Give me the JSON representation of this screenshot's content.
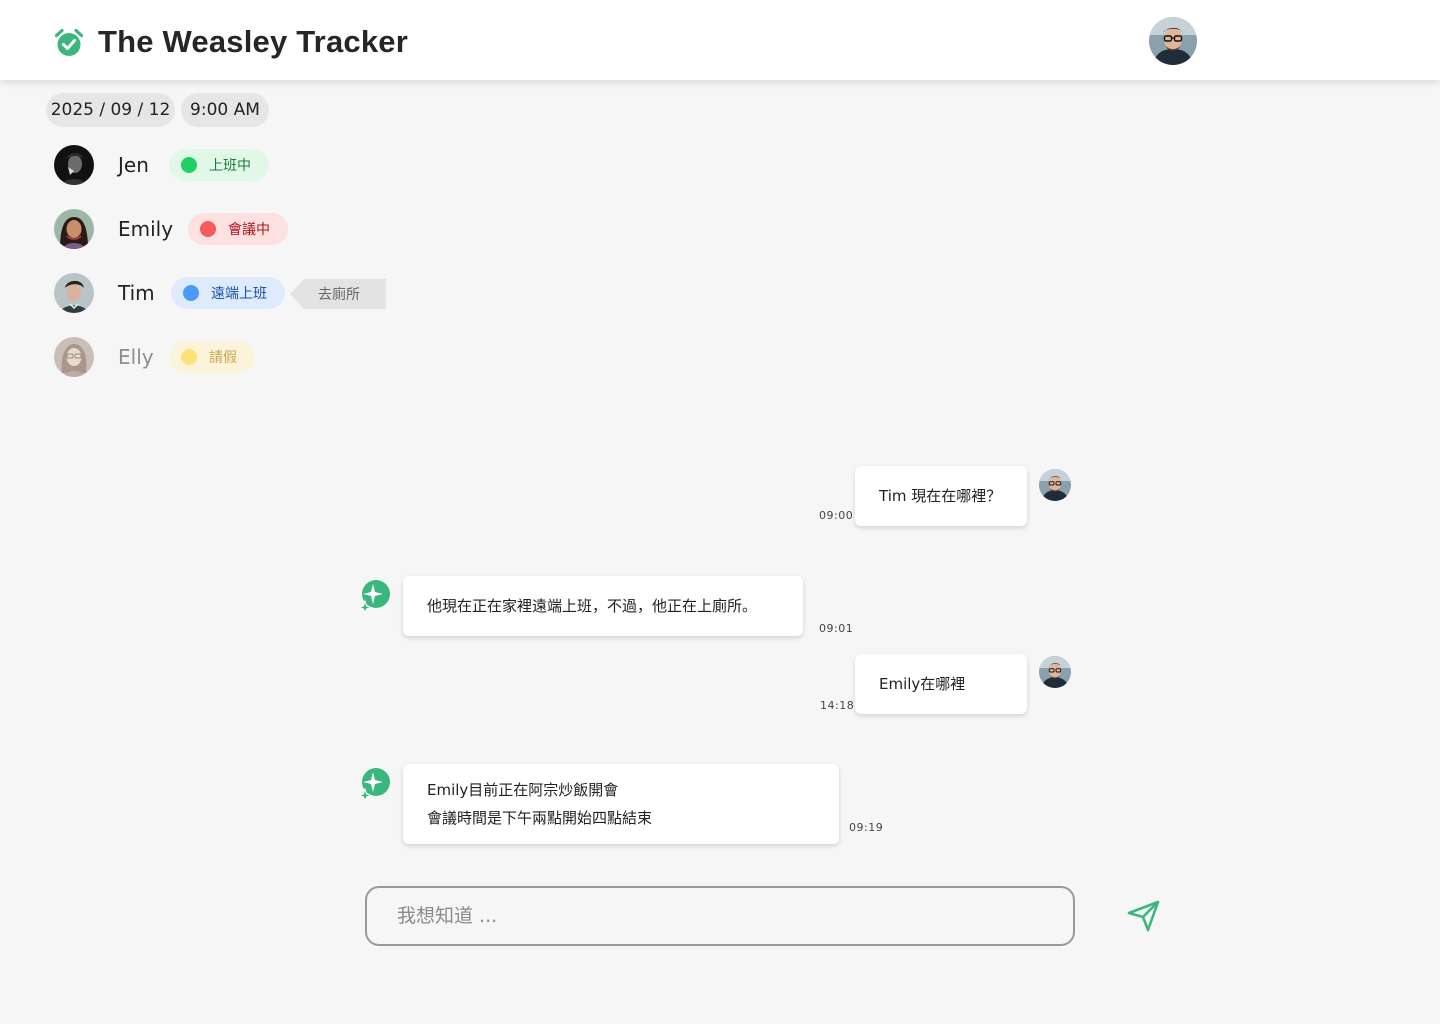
{
  "app": {
    "title": "The Weasley Tracker",
    "logo_icon": "alarm-clock-check-icon",
    "accent_color": "#3bb77e"
  },
  "header": {
    "user_avatar": "user-avatar-glasses"
  },
  "datetime": {
    "date": "2025 / 09 / 12",
    "time": "9:00 AM"
  },
  "people": [
    {
      "name": "Jen",
      "status": "上班中",
      "status_color": "#1fd162",
      "activity": ""
    },
    {
      "name": "Emily",
      "status": "會議中",
      "status_color": "#f65a5f",
      "activity": ""
    },
    {
      "name": "Tim",
      "status": "遠端上班",
      "status_color": "#4a9bf5",
      "activity": "去廁所"
    },
    {
      "name": "Elly",
      "status": "請假",
      "status_color": "#fde27a",
      "activity": ""
    }
  ],
  "chat": {
    "messages": [
      {
        "sender": "user",
        "lines": [
          "Tim 現在在哪裡？"
        ],
        "time": "09:00"
      },
      {
        "sender": "bot",
        "lines": [
          "他現在正在家裡遠端上班，不過，他正在上廁所。"
        ],
        "time": "09:01"
      },
      {
        "sender": "user",
        "lines": [
          "Emily在哪裡"
        ],
        "time": "14:18"
      },
      {
        "sender": "bot",
        "lines": [
          "Emily目前正在阿宗炒飯開會",
          "會議時間是下午兩點開始四點結束"
        ],
        "time": "09:19"
      }
    ]
  },
  "input": {
    "placeholder": "我想知道 ...",
    "value": ""
  },
  "send": {
    "icon": "send-paper-plane-icon"
  }
}
